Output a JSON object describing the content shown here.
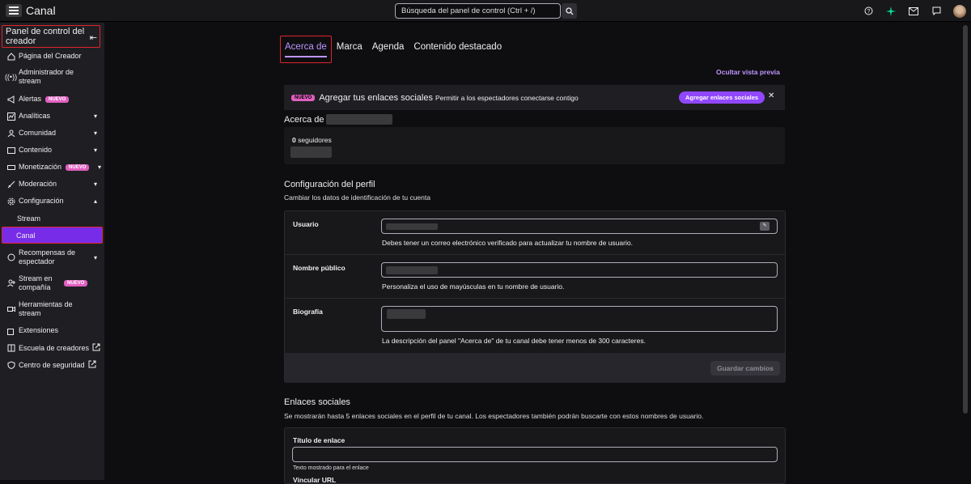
{
  "topbar": {
    "title": "Canal",
    "search_placeholder": "Búsqueda del panel de control (Ctrl + /)"
  },
  "sidebar": {
    "header": "Panel de control del creador",
    "items": [
      {
        "label": "Página del Creador"
      },
      {
        "label": "Administrador de stream"
      },
      {
        "label": "Alertas",
        "badge": "NUEVO"
      },
      {
        "label": "Analíticas"
      },
      {
        "label": "Comunidad"
      },
      {
        "label": "Contenido"
      },
      {
        "label": "Monetización",
        "badge": "NUEVO"
      },
      {
        "label": "Moderación"
      },
      {
        "label": "Configuración"
      },
      {
        "label": "Recompensas de espectador"
      },
      {
        "label": "Stream en compañía",
        "badge": "NUEVO"
      },
      {
        "label": "Herramientas de stream"
      },
      {
        "label": "Extensiones"
      },
      {
        "label": "Escuela de creadores"
      },
      {
        "label": "Centro de seguridad"
      }
    ],
    "sub_items": {
      "stream": "Stream",
      "canal": "Canal"
    }
  },
  "tabs": [
    "Acerca de",
    "Marca",
    "Agenda",
    "Contenido destacado"
  ],
  "hide_preview": "Ocultar vista previa",
  "promo": {
    "badge": "NUEVO",
    "title": "Agregar tus enlaces sociales",
    "desc": "Permitir a los espectadores conectarse contigo",
    "button": "Agregar enlaces sociales",
    "close": "✕"
  },
  "about": {
    "heading": "Acerca de",
    "followers_count": "0",
    "followers_label": "seguidores"
  },
  "profile": {
    "title": "Configuración del perfil",
    "desc": "Cambiar los datos de identificación de tu cuenta",
    "username_label": "Usuario",
    "username_help": "Debes tener un correo electrónico verificado para actualizar tu nombre de usuario.",
    "display_label": "Nombre público",
    "display_help": "Personaliza el uso de mayúsculas en tu nombre de usuario.",
    "bio_label": "Biografía",
    "bio_help": "La descripción del panel \"Acerca de\" de tu canal debe tener menos de 300 caracteres.",
    "save": "Guardar cambios"
  },
  "social": {
    "title": "Enlaces sociales",
    "desc": "Se mostrarán hasta 5 enlaces sociales en el perfil de tu canal. Los espectadores también podrán buscarte con estos nombres de usuario.",
    "link_title_label": "Título de enlace",
    "link_title_help": "Texto mostrado para el enlace",
    "url_label": "Vincular URL"
  }
}
